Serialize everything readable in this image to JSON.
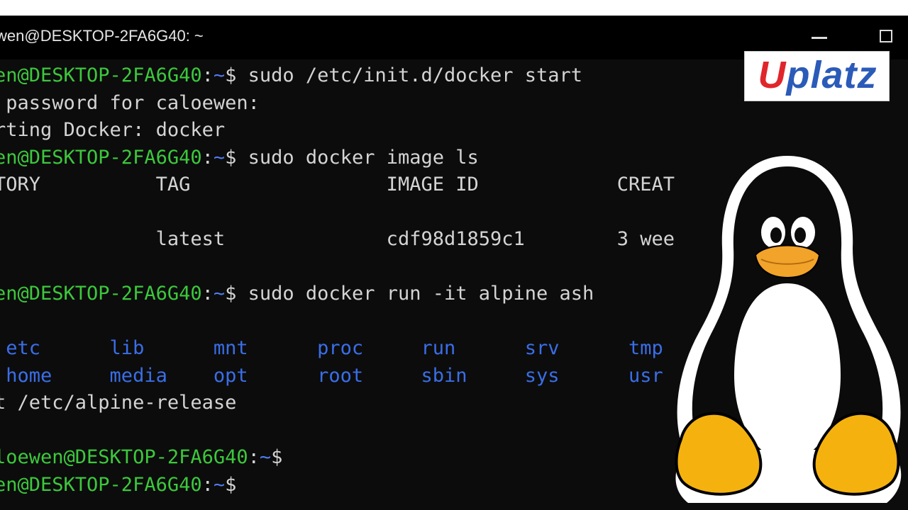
{
  "window": {
    "title": "wen@DESKTOP-2FA6G40: ~"
  },
  "terminal": {
    "lines": [
      [
        {
          "t": "en@DESKTOP-2FA6G40",
          "c": "g"
        },
        {
          "t": ":",
          "c": "w"
        },
        {
          "t": "~",
          "c": "b"
        },
        {
          "t": "$ sudo /etc/init.d/docker start",
          "c": "w"
        }
      ],
      [
        {
          "t": " password for caloewen:",
          "c": "w"
        }
      ],
      [
        {
          "t": "rting Docker: docker",
          "c": "w"
        }
      ],
      [
        {
          "t": "en@DESKTOP-2FA6G40",
          "c": "g"
        },
        {
          "t": ":",
          "c": "w"
        },
        {
          "t": "~",
          "c": "b"
        },
        {
          "t": "$ sudo docker image ls",
          "c": "w"
        }
      ],
      [
        {
          "t": "TORY          TAG                 IMAGE ID            CREAT",
          "c": "w"
        }
      ],
      [
        {
          "t": "",
          "c": "w"
        }
      ],
      [
        {
          "t": "              latest              cdf98d1859c1        3 wee",
          "c": "w"
        }
      ],
      [
        {
          "t": "",
          "c": "w"
        }
      ],
      [
        {
          "t": "en@DESKTOP-2FA6G40",
          "c": "g"
        },
        {
          "t": ":",
          "c": "w"
        },
        {
          "t": "~",
          "c": "b"
        },
        {
          "t": "$ sudo docker run -it alpine ash",
          "c": "w"
        }
      ],
      [
        {
          "t": "",
          "c": "w"
        }
      ],
      [
        {
          "t": " etc      lib      mnt      proc     run      srv      tmp      var",
          "c": "cyan"
        }
      ],
      [
        {
          "t": " home     media    opt      root     sbin     sys      usr",
          "c": "cyan"
        }
      ],
      [
        {
          "t": "t /etc/alpine-release",
          "c": "w"
        }
      ],
      [
        {
          "t": "",
          "c": "w"
        }
      ],
      [
        {
          "t": "loewen@DESKTOP-2FA6G40",
          "c": "g"
        },
        {
          "t": ":",
          "c": "w"
        },
        {
          "t": "~",
          "c": "b"
        },
        {
          "t": "$",
          "c": "w"
        }
      ],
      [
        {
          "t": "en@DESKTOP-2FA6G40",
          "c": "g"
        },
        {
          "t": ":",
          "c": "w"
        },
        {
          "t": "~",
          "c": "b"
        },
        {
          "t": "$",
          "c": "w"
        }
      ]
    ]
  },
  "logo": {
    "first": "U",
    "rest": "platz"
  },
  "icons": [
    "minimize-icon",
    "maximize-icon",
    "tux-penguin-icon"
  ]
}
